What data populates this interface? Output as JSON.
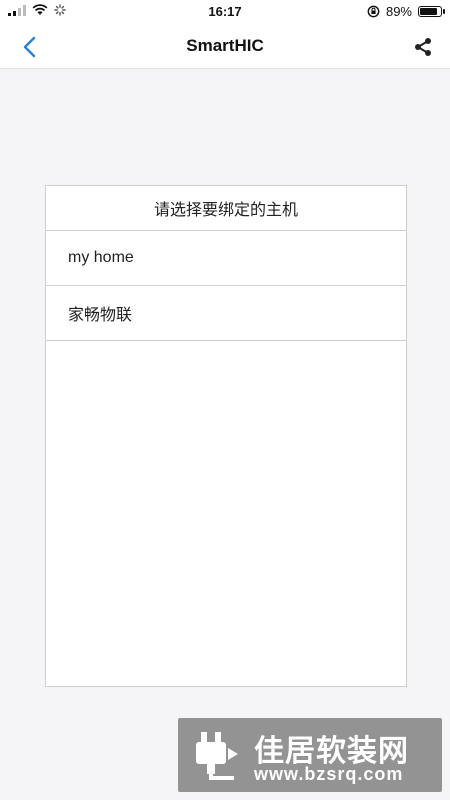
{
  "status_bar": {
    "time": "16:17",
    "battery_percent": "89%",
    "battery_level": 0.89
  },
  "nav": {
    "title": "SmartHIC",
    "back_icon": "chevron-left-icon",
    "share_icon": "share-icon"
  },
  "host_panel": {
    "header": "请选择要绑定的主机",
    "items": [
      {
        "label": "my home"
      },
      {
        "label": "家畅物联"
      }
    ]
  },
  "watermark": {
    "name": "佳居软装网",
    "url": "www.bzsrq.com"
  },
  "colors": {
    "accent": "#2a7fd4",
    "background": "#f5f4f7",
    "border": "#cfcfcf"
  }
}
